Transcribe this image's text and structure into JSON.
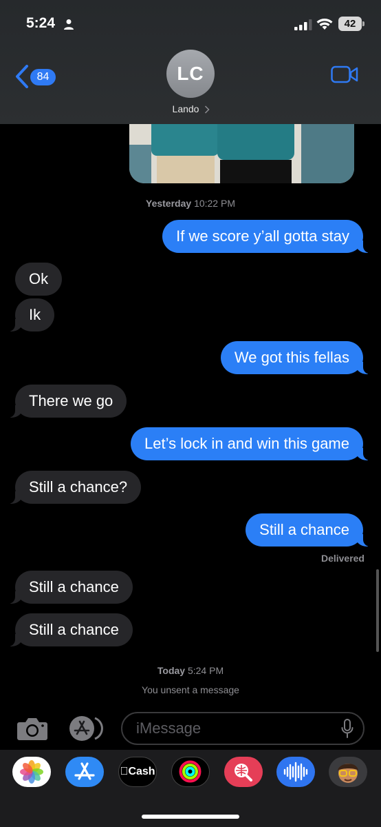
{
  "status_bar": {
    "time": "5:24",
    "battery": "42"
  },
  "header": {
    "back_count": "84",
    "avatar_initials": "LC",
    "contact_name": "Lando"
  },
  "timestamps": {
    "yesterday_day": "Yesterday",
    "yesterday_time": "10:22 PM",
    "today_day": "Today",
    "today_time": "5:24 PM"
  },
  "messages": [
    {
      "dir": "out",
      "text": "If we score y’all gotta stay"
    },
    {
      "dir": "in",
      "text": "Ok"
    },
    {
      "dir": "in",
      "text": "Ik"
    },
    {
      "dir": "out",
      "text": "We got this fellas"
    },
    {
      "dir": "in",
      "text": "There we go"
    },
    {
      "dir": "out",
      "text": "Let’s lock in and win this game"
    },
    {
      "dir": "in",
      "text": "Still a chance?"
    },
    {
      "dir": "out",
      "text": "Still a chance"
    },
    {
      "dir": "in",
      "text": "Still a chance"
    },
    {
      "dir": "in",
      "text": "Still a chance"
    }
  ],
  "delivery_status": "Delivered",
  "unsent_notice": "You unsent a message",
  "compose": {
    "placeholder": "iMessage"
  },
  "app_drawer": {
    "cash_label": "Cash"
  },
  "colors": {
    "outgoing": "#2b7ff6",
    "incoming": "#262629",
    "accent": "#2f7af4"
  }
}
